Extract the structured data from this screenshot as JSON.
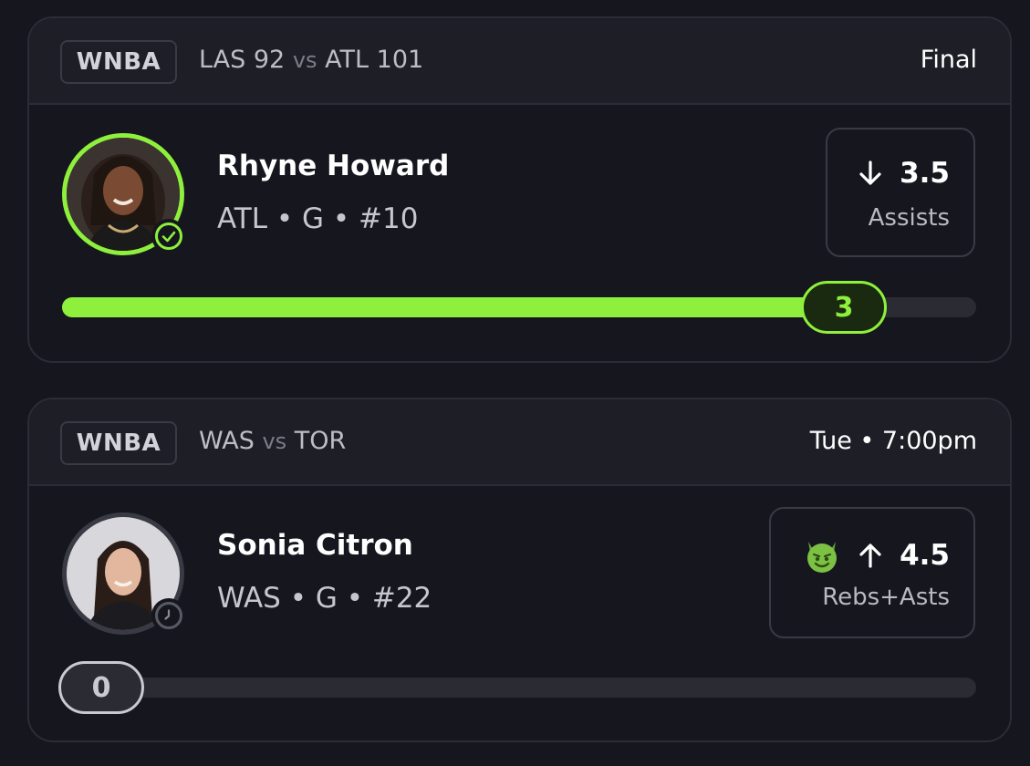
{
  "cards": [
    {
      "league": "WNBA",
      "matchup": {
        "team1": "LAS",
        "score1": "92",
        "vs": "vs",
        "team2": "ATL",
        "score2": "101"
      },
      "status": "Final",
      "player": {
        "name": "Rhyne Howard",
        "meta": "ATL • G • #10",
        "status_icon": "check-icon"
      },
      "line": {
        "direction_icon": "arrow-down-icon",
        "value": "3.5",
        "stat": "Assists"
      },
      "progress": {
        "current": "3",
        "line": 3.5,
        "fraction": 0.855,
        "state": "won"
      }
    },
    {
      "league": "WNBA",
      "matchup": {
        "team1": "WAS",
        "score1": "",
        "vs": "vs",
        "team2": "TOR",
        "score2": ""
      },
      "status": "Tue • 7:00pm",
      "player": {
        "name": "Sonia Citron",
        "meta": "WAS • G • #22",
        "status_icon": "clock-icon"
      },
      "line": {
        "badge_icon": "devil-emoji-icon",
        "direction_icon": "arrow-up-icon",
        "value": "4.5",
        "stat": "Rebs+Asts"
      },
      "progress": {
        "current": "0",
        "line": 4.5,
        "fraction": 0.0,
        "state": "pending"
      }
    }
  ],
  "colors": {
    "accent": "#8ef03c",
    "background": "#16161f",
    "header": "#1e1e27",
    "border": "#2c2c36"
  }
}
